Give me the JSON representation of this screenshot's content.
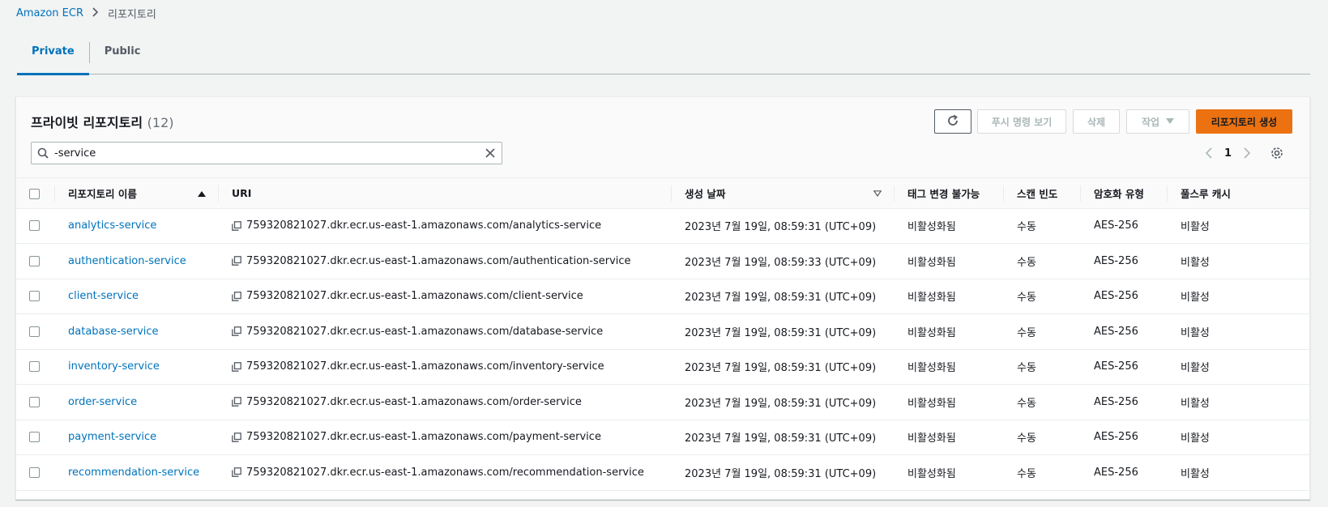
{
  "breadcrumb": {
    "root": "Amazon ECR",
    "separator": ">",
    "current": "리포지토리"
  },
  "tabs": [
    {
      "label": "Private",
      "active": true
    },
    {
      "label": "Public",
      "active": false
    }
  ],
  "panel": {
    "title": "프라이빗 리포지토리",
    "count": "(12)"
  },
  "toolbar": {
    "push_label": "푸시 명령 보기",
    "delete_label": "삭제",
    "actions_label": "작업",
    "create_label": "리포지토리 생성"
  },
  "search": {
    "value": "-service"
  },
  "pagination": {
    "page": "1"
  },
  "columns": {
    "name": "리포지토리 이름",
    "uri": "URI",
    "created": "생성 날짜",
    "tag_immutability": "태그 변경 불가능",
    "scan_frequency": "스캔 빈도",
    "encryption": "암호화 유형",
    "pull_through_cache": "풀스루 캐시"
  },
  "rows": [
    {
      "name": "analytics-service",
      "uri": "759320821027.dkr.ecr.us-east-1.amazonaws.com/analytics-service",
      "created": "2023년 7월 19일, 08:59:31 (UTC+09)",
      "tag": "비활성화됨",
      "scan": "수동",
      "enc": "AES-256",
      "cache": "비활성"
    },
    {
      "name": "authentication-service",
      "uri": "759320821027.dkr.ecr.us-east-1.amazonaws.com/authentication-service",
      "created": "2023년 7월 19일, 08:59:33 (UTC+09)",
      "tag": "비활성화됨",
      "scan": "수동",
      "enc": "AES-256",
      "cache": "비활성"
    },
    {
      "name": "client-service",
      "uri": "759320821027.dkr.ecr.us-east-1.amazonaws.com/client-service",
      "created": "2023년 7월 19일, 08:59:31 (UTC+09)",
      "tag": "비활성화됨",
      "scan": "수동",
      "enc": "AES-256",
      "cache": "비활성"
    },
    {
      "name": "database-service",
      "uri": "759320821027.dkr.ecr.us-east-1.amazonaws.com/database-service",
      "created": "2023년 7월 19일, 08:59:31 (UTC+09)",
      "tag": "비활성화됨",
      "scan": "수동",
      "enc": "AES-256",
      "cache": "비활성"
    },
    {
      "name": "inventory-service",
      "uri": "759320821027.dkr.ecr.us-east-1.amazonaws.com/inventory-service",
      "created": "2023년 7월 19일, 08:59:31 (UTC+09)",
      "tag": "비활성화됨",
      "scan": "수동",
      "enc": "AES-256",
      "cache": "비활성"
    },
    {
      "name": "order-service",
      "uri": "759320821027.dkr.ecr.us-east-1.amazonaws.com/order-service",
      "created": "2023년 7월 19일, 08:59:31 (UTC+09)",
      "tag": "비활성화됨",
      "scan": "수동",
      "enc": "AES-256",
      "cache": "비활성"
    },
    {
      "name": "payment-service",
      "uri": "759320821027.dkr.ecr.us-east-1.amazonaws.com/payment-service",
      "created": "2023년 7월 19일, 08:59:31 (UTC+09)",
      "tag": "비활성화됨",
      "scan": "수동",
      "enc": "AES-256",
      "cache": "비활성"
    },
    {
      "name": "recommendation-service",
      "uri": "759320821027.dkr.ecr.us-east-1.amazonaws.com/recommendation-service",
      "created": "2023년 7월 19일, 08:59:31 (UTC+09)",
      "tag": "비활성화됨",
      "scan": "수동",
      "enc": "AES-256",
      "cache": "비활성"
    }
  ],
  "colors": {
    "link": "#0073bb",
    "primary_button": "#ec7211",
    "page_bg": "#f2f3f3"
  }
}
